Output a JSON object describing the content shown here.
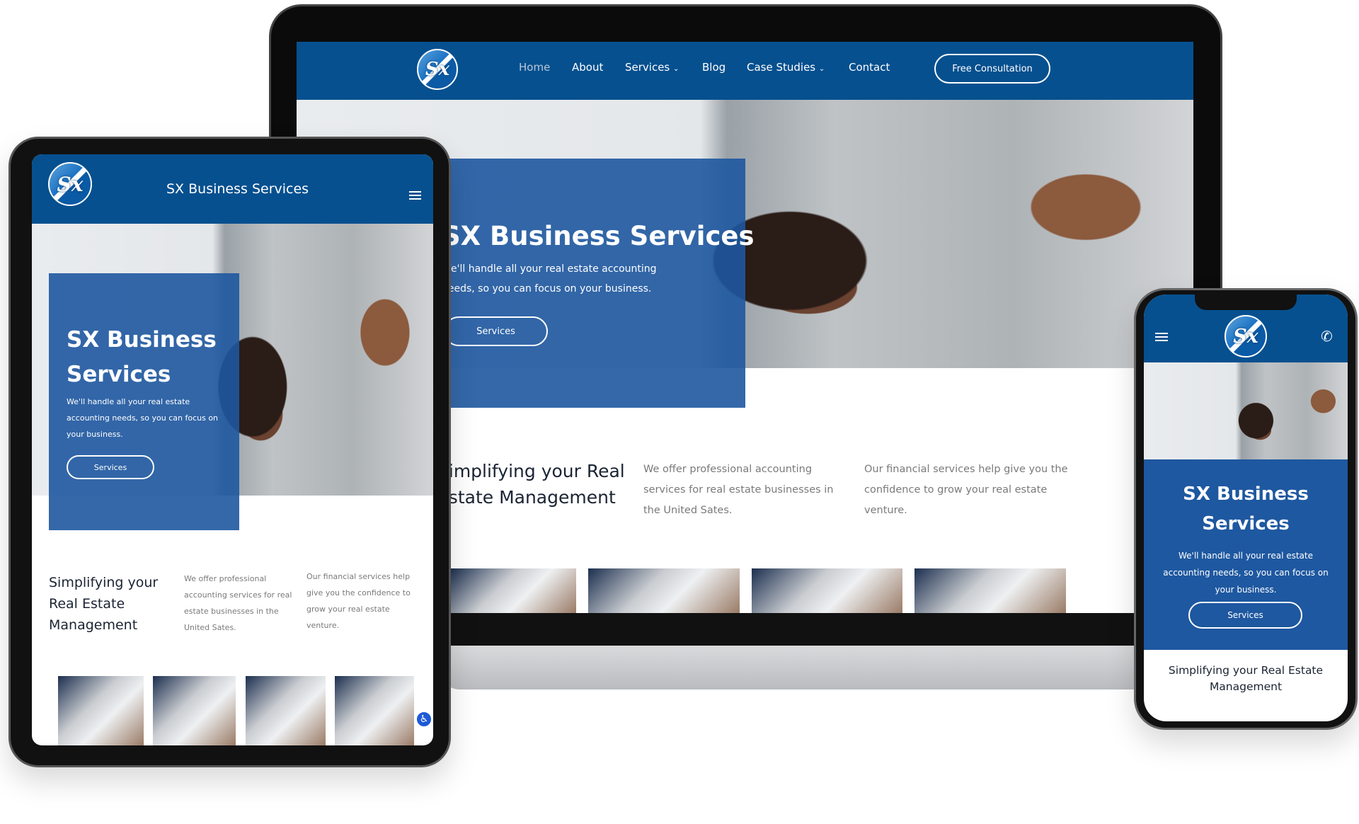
{
  "laptop": {
    "nav": {
      "items": [
        "Home",
        "About",
        "Services",
        "Blog",
        "Case Studies",
        "Contact"
      ],
      "cta": "Free Consultation",
      "logo_text": "Sx"
    },
    "hero": {
      "title": "SX Business Services",
      "subtitle_line1": "We'll handle all your real estate accounting",
      "subtitle_line2": "needs, so you can focus on your business.",
      "button": "Services"
    },
    "intro": {
      "heading_line1": "Simplifying your Real",
      "heading_line2": "Estate Management",
      "col1": "We offer professional accounting services for real estate businesses in the United Sates.",
      "col2": "Our financial services help give you the confidence to grow your real estate venture."
    }
  },
  "tablet": {
    "header_title": "SX Business Services",
    "logo_text": "Sx",
    "hero": {
      "title": "SX Business Services",
      "subtitle": "We'll handle all your real estate accounting needs, so you can focus on your business.",
      "button": "Services"
    },
    "intro": {
      "heading": "Simplifying your Real Estate Management",
      "col1": "We offer professional accounting services for real estate businesses in the United Sates.",
      "col2": "Our financial services help give you the confidence to grow your real estate venture."
    }
  },
  "phone": {
    "logo_text": "Sx",
    "hero": {
      "title": "SX Business Services",
      "subtitle": "We'll handle all your real estate accounting needs, so you can focus on your business.",
      "button": "Services"
    },
    "intro": {
      "heading": "Simplifying your Real Estate Management"
    }
  },
  "colors": {
    "brand_blue": "#06508f",
    "hero_blue": "#1e58a0"
  }
}
